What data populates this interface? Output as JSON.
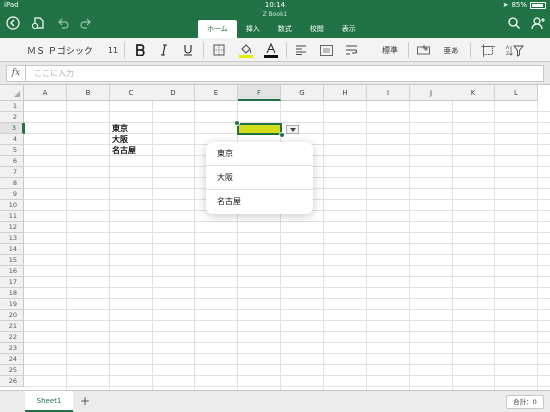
{
  "status_bar": {
    "device": "iPad",
    "time": "10:14",
    "battery": "85%"
  },
  "document": {
    "title": "Z Book1"
  },
  "tabs": [
    "ホーム",
    "挿入",
    "数式",
    "校閲",
    "表示"
  ],
  "ribbon": {
    "font_name": "ＭＳ Ｐゴシック",
    "font_size": "11",
    "number_format": "標準",
    "orientation": "亜あ"
  },
  "formula_bar": {
    "placeholder": "ここに入力",
    "fx_label": "fx"
  },
  "columns": [
    "A",
    "B",
    "C",
    "D",
    "E",
    "F",
    "G",
    "H",
    "I",
    "J",
    "K",
    "L"
  ],
  "rows": [
    "1",
    "2",
    "3",
    "4",
    "5",
    "6",
    "7",
    "8",
    "9",
    "10",
    "11",
    "12",
    "13",
    "14",
    "15",
    "16",
    "17",
    "18",
    "19",
    "20",
    "21",
    "22",
    "23",
    "24",
    "25",
    "26"
  ],
  "cells": {
    "C3": "東京",
    "C4": "大阪",
    "C5": "名古屋"
  },
  "selected": {
    "column": "F",
    "row": "3"
  },
  "dropdown_list": [
    "東京",
    "大阪",
    "名古屋"
  ],
  "sheet_tabs": [
    "Sheet1"
  ],
  "add_sheet_label": "+",
  "status_summary": "合計：0",
  "colors": {
    "accent": "#217346",
    "selected_fill": "#d4dc1e"
  }
}
